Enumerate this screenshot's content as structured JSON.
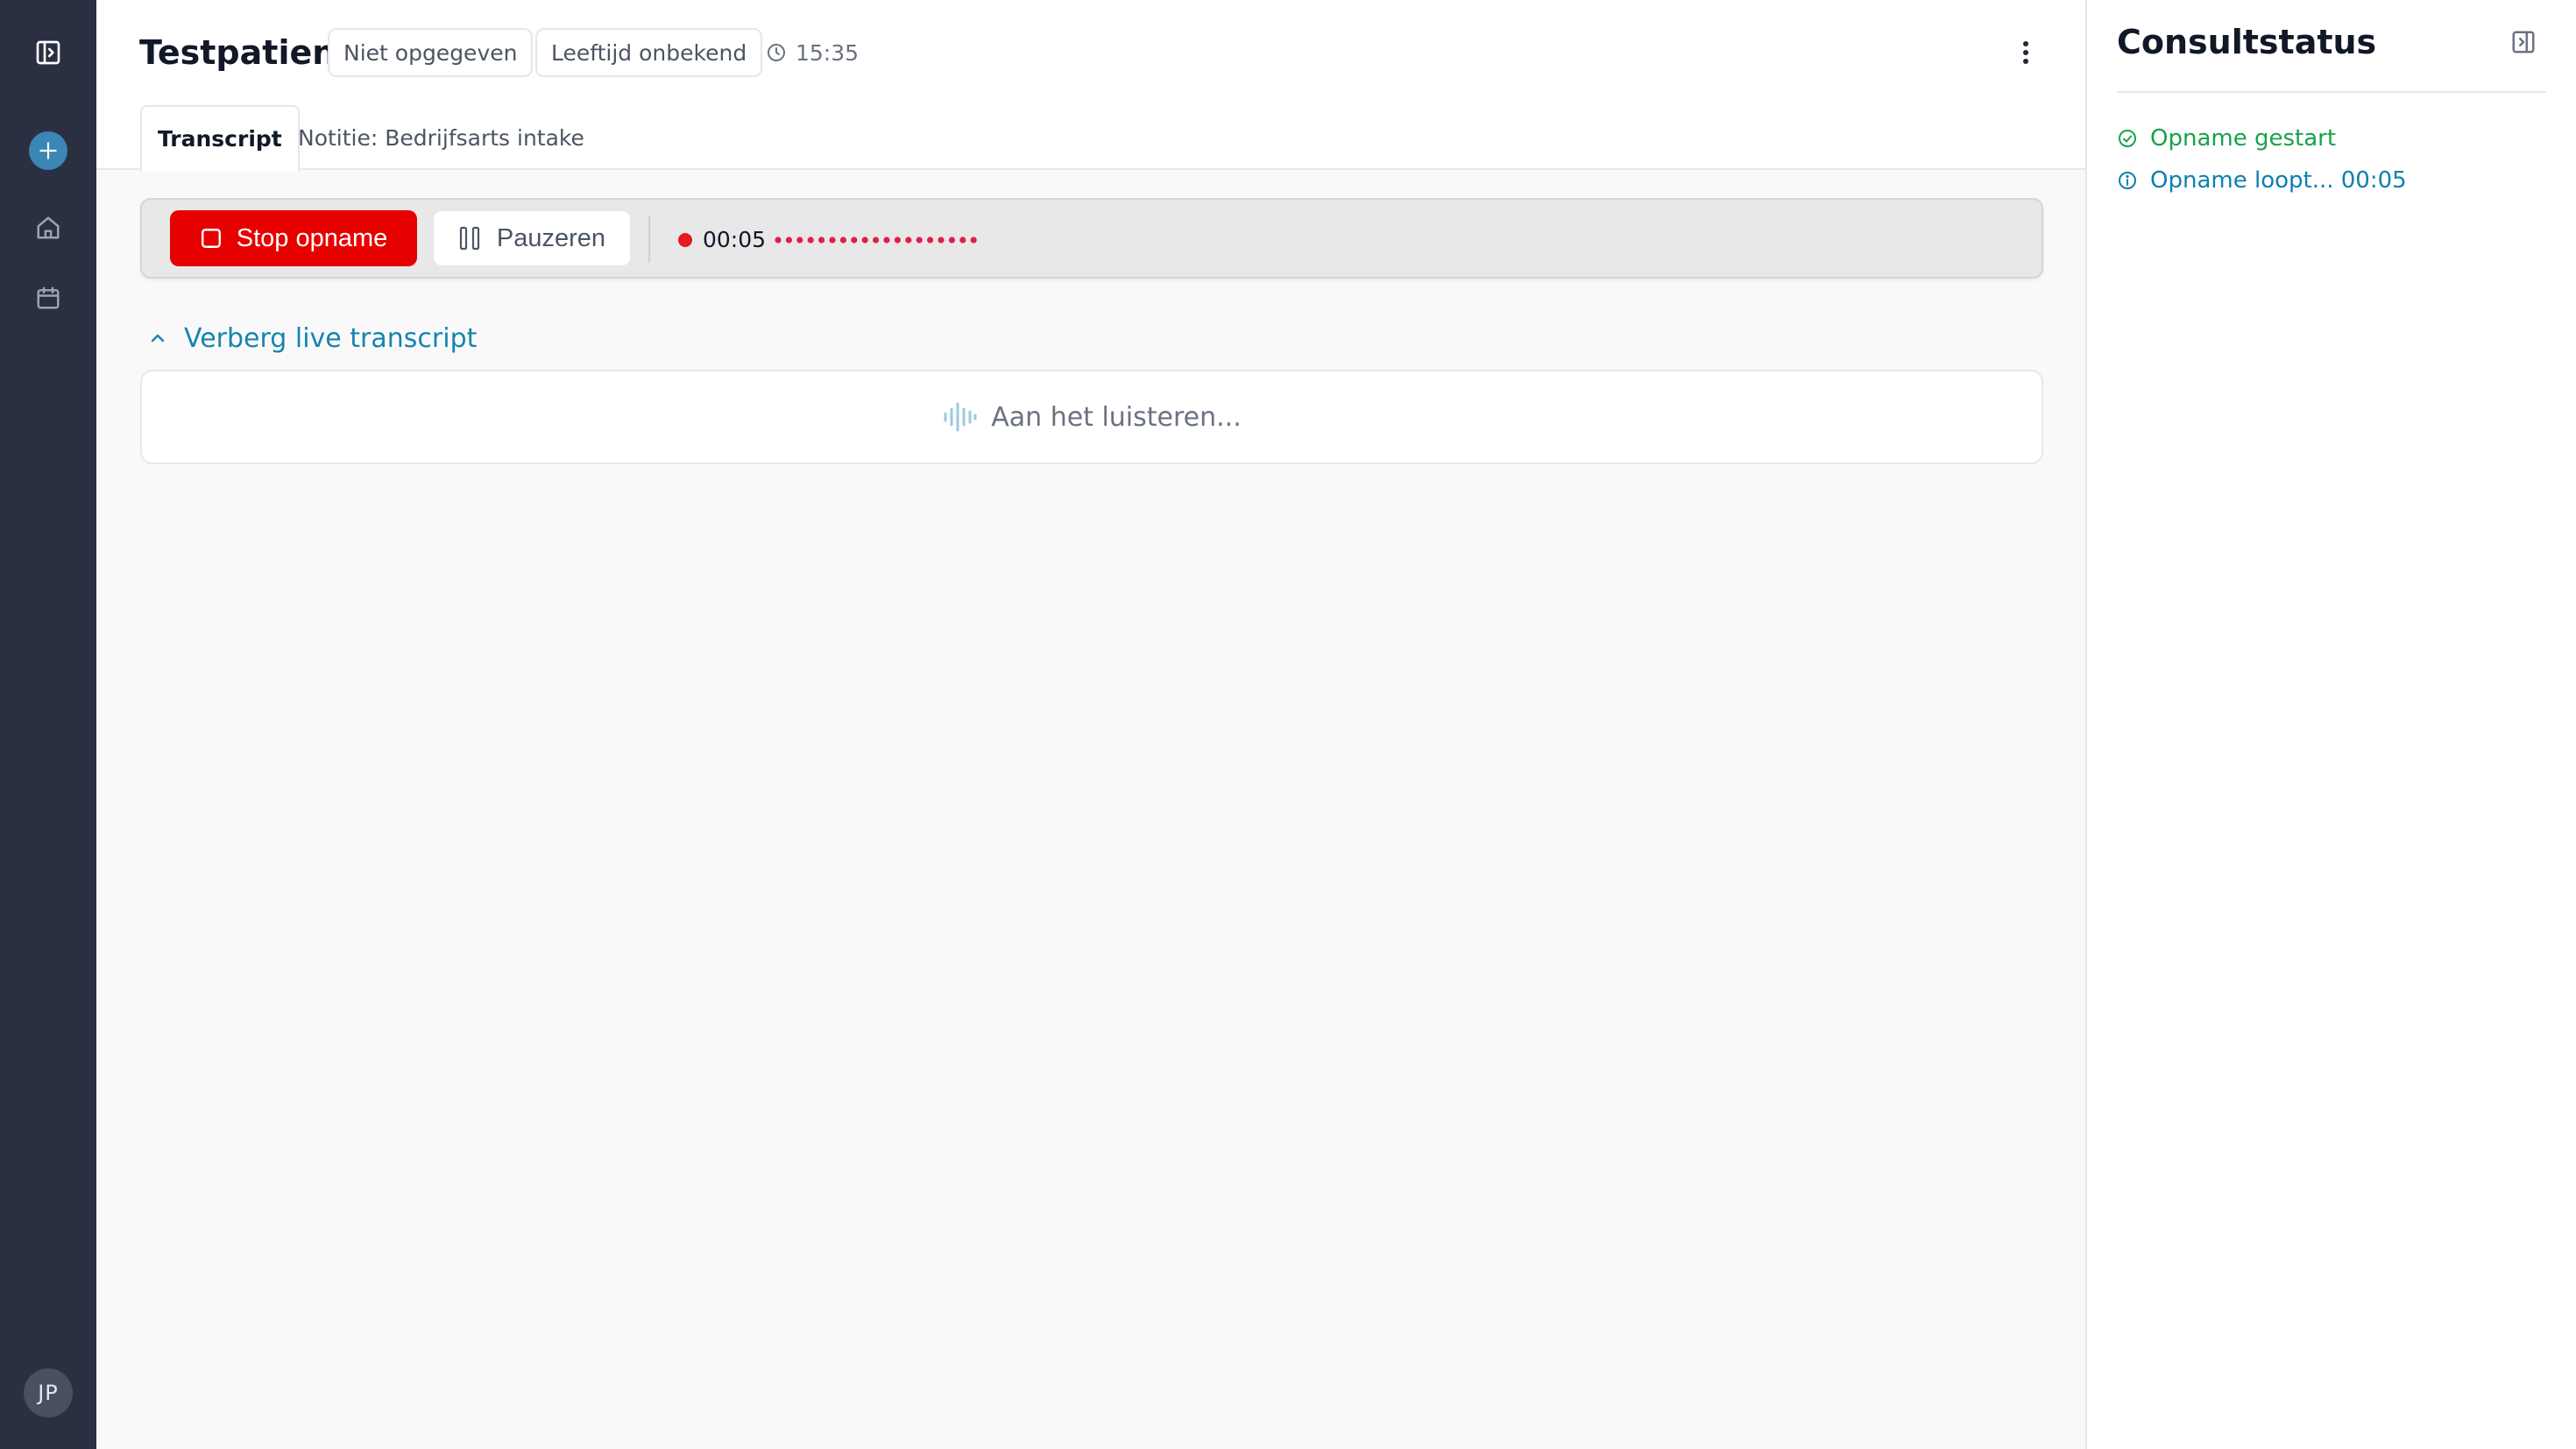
{
  "sidebar": {
    "toggle_icon": "sidebar-toggle-icon",
    "new_icon": "plus-icon",
    "home_icon": "home-icon",
    "calendar_icon": "calendar-icon",
    "avatar_initials": "JP"
  },
  "header": {
    "patient_name": "Testpatient",
    "gender_chip": "Niet opgegeven",
    "age_chip": "Leeftijd onbekend",
    "time": "15:35",
    "time_icon": "clock-icon",
    "menu_icon": "more-vertical-icon"
  },
  "tabs": [
    {
      "label": "Transcript",
      "active": true
    },
    {
      "label": "Notitie: Bedrijfsarts intake",
      "active": false
    }
  ],
  "recording": {
    "stop_label": "Stop opname",
    "pause_label": "Pauzeren",
    "elapsed": "00:05"
  },
  "transcript": {
    "toggle_label": "Verberg live transcript",
    "listening_text": "Aan het luisteren..."
  },
  "status_panel": {
    "title": "Consultstatus",
    "items": [
      {
        "label": "Opname gestart",
        "state": "done",
        "icon": "check-circle-icon"
      },
      {
        "label": "Opname loopt... 00:05",
        "state": "in-progress",
        "icon": "info-circle-icon"
      }
    ]
  },
  "colors": {
    "sidebar_bg": "#2a2f42",
    "accent_blue": "#1684b0",
    "record_red": "#e60000",
    "success_green": "#16a34a"
  }
}
